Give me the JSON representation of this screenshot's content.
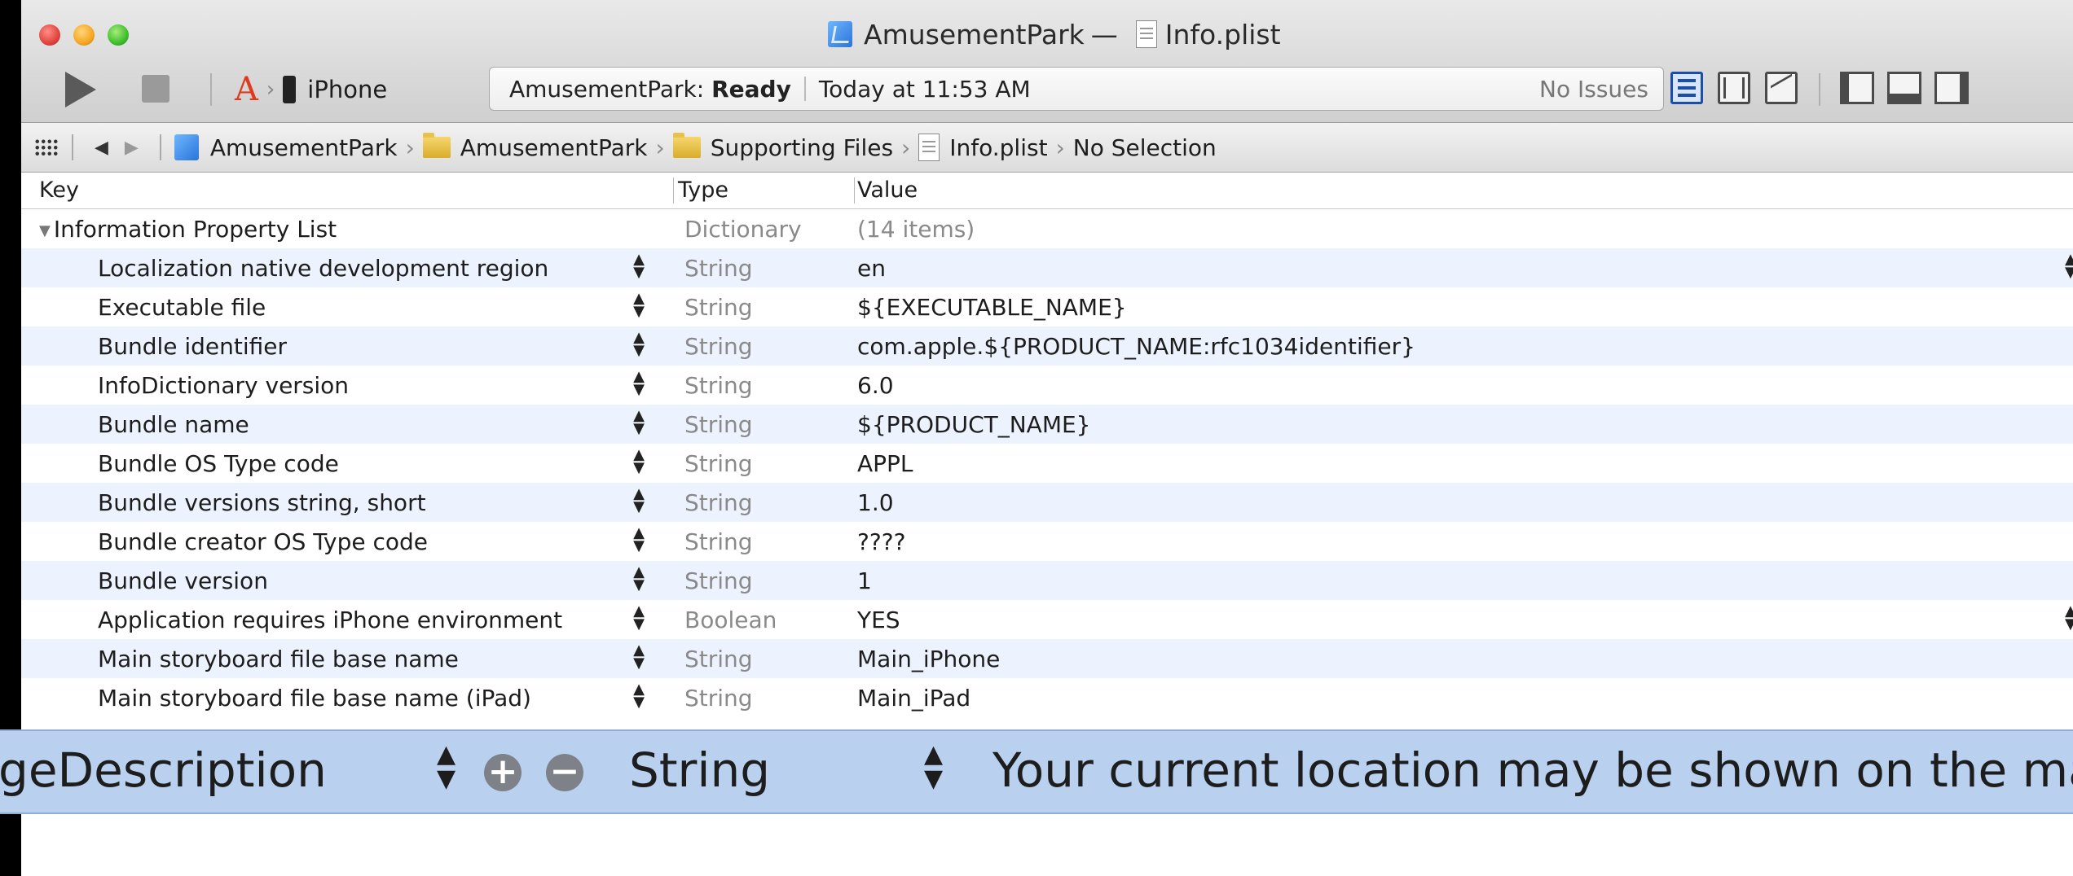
{
  "window": {
    "title_project": "AmusementPark",
    "title_separator": "—",
    "title_file": "Info.plist"
  },
  "toolbar": {
    "scheme_device": "iPhone",
    "activity_project": "AmusementPark:",
    "activity_status": "Ready",
    "activity_time": "Today at 11:53 AM",
    "activity_issues": "No Issues"
  },
  "jumpbar": {
    "crumbs": [
      "AmusementPark",
      "AmusementPark",
      "Supporting Files",
      "Info.plist",
      "No Selection"
    ]
  },
  "table": {
    "headers": {
      "key": "Key",
      "type": "Type",
      "value": "Value"
    },
    "root": {
      "key": "Information Property List",
      "type": "Dictionary",
      "value": "(14 items)"
    },
    "rows": [
      {
        "key": "Localization native development region",
        "type": "String",
        "value": "en"
      },
      {
        "key": "Executable file",
        "type": "String",
        "value": "${EXECUTABLE_NAME}"
      },
      {
        "key": "Bundle identifier",
        "type": "String",
        "value": "com.apple.${PRODUCT_NAME:rfc1034identifier}"
      },
      {
        "key": "InfoDictionary version",
        "type": "String",
        "value": "6.0"
      },
      {
        "key": "Bundle name",
        "type": "String",
        "value": "${PRODUCT_NAME}"
      },
      {
        "key": "Bundle OS Type code",
        "type": "String",
        "value": "APPL"
      },
      {
        "key": "Bundle versions string, short",
        "type": "String",
        "value": "1.0"
      },
      {
        "key": "Bundle creator OS Type code",
        "type": "String",
        "value": "????"
      },
      {
        "key": "Bundle version",
        "type": "String",
        "value": "1"
      },
      {
        "key": "Application requires iPhone environment",
        "type": "Boolean",
        "value": "YES"
      },
      {
        "key": "Main storyboard file base name",
        "type": "String",
        "value": "Main_iPhone"
      },
      {
        "key": "Main storyboard file base name (iPad)",
        "type": "String",
        "value": "Main_iPad"
      }
    ]
  },
  "zoom_row": {
    "key": "geDescription",
    "type": "String",
    "value": "Your current location may be shown on the map"
  }
}
